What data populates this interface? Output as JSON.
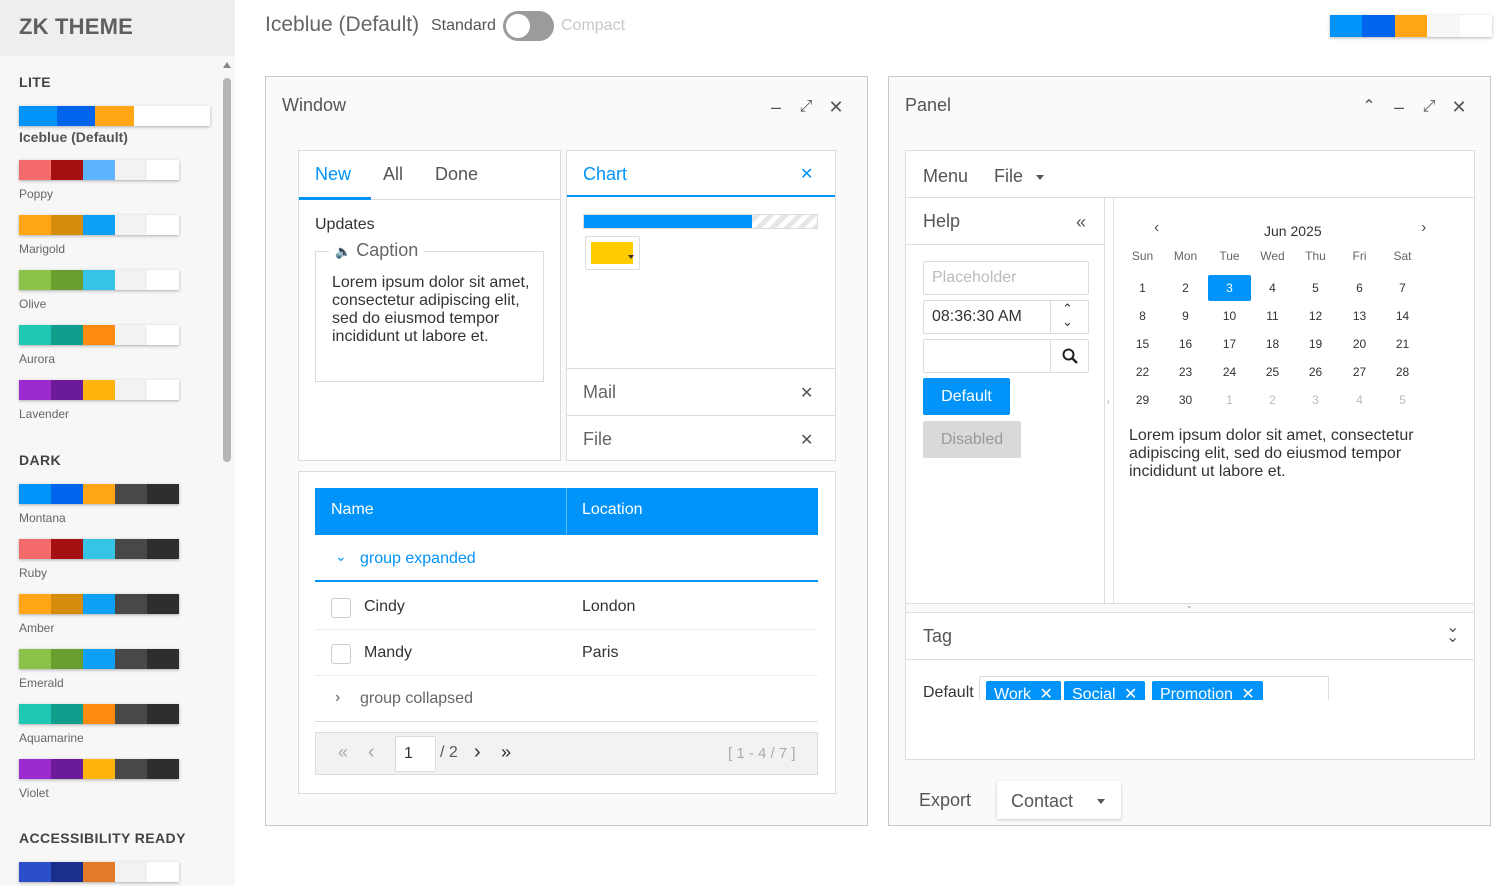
{
  "sidebar": {
    "brand": "ZK THEME",
    "sections": {
      "lite": "LITE",
      "dark": "DARK",
      "accessibility": "ACCESSIBILITY READY"
    },
    "lite_themes": [
      {
        "name": "Iceblue (Default)",
        "colors": [
          "#0093f9",
          "#0064ed",
          "#ffa516",
          "#ffffff",
          "#ffffff"
        ]
      },
      {
        "name": "Poppy",
        "colors": [
          "#f56a6a",
          "#a50f11",
          "#5cb4ff",
          "#f2f2f2",
          "#ffffff"
        ]
      },
      {
        "name": "Marigold",
        "colors": [
          "#ffa516",
          "#d48c0a",
          "#0ea0f5",
          "#f2f2f2",
          "#ffffff"
        ]
      },
      {
        "name": "Olive",
        "colors": [
          "#8bc34a",
          "#6a9f2f",
          "#36c4e6",
          "#f2f2f2",
          "#ffffff"
        ]
      },
      {
        "name": "Aurora",
        "colors": [
          "#1ec8b4",
          "#129e8c",
          "#ff8a10",
          "#f2f2f2",
          "#ffffff"
        ]
      },
      {
        "name": "Lavender",
        "colors": [
          "#9b2bcf",
          "#6b1a99",
          "#ffb50e",
          "#f2f2f2",
          "#ffffff"
        ]
      }
    ],
    "dark_themes": [
      {
        "name": "Montana",
        "colors": [
          "#0093f9",
          "#0064ed",
          "#ffa516",
          "#484848",
          "#2e2e2e"
        ]
      },
      {
        "name": "Ruby",
        "colors": [
          "#f56a6a",
          "#a50f11",
          "#36c4e6",
          "#484848",
          "#2e2e2e"
        ]
      },
      {
        "name": "Amber",
        "colors": [
          "#ffa516",
          "#d48c0a",
          "#0ea0f5",
          "#484848",
          "#2e2e2e"
        ]
      },
      {
        "name": "Emerald",
        "colors": [
          "#8bc34a",
          "#6a9f2f",
          "#0ea0f5",
          "#484848",
          "#2e2e2e"
        ]
      },
      {
        "name": "Aquamarine",
        "colors": [
          "#1ec8b4",
          "#129e8c",
          "#ff8a10",
          "#484848",
          "#2e2e2e"
        ]
      },
      {
        "name": "Violet",
        "colors": [
          "#9b2bcf",
          "#6b1a99",
          "#ffb50e",
          "#484848",
          "#2e2e2e"
        ]
      }
    ],
    "accessibility_themes": [
      {
        "name": "",
        "colors": [
          "#2b4fc9",
          "#1a2f8c",
          "#e27a28",
          "#f2f2f2",
          "#ffffff"
        ]
      }
    ]
  },
  "topbar": {
    "current_theme": "Iceblue (Default)",
    "standard_label": "Standard",
    "compact_label": "Compact",
    "swatch_colors": [
      "#0093f9",
      "#0064ed",
      "#ffa516",
      "#f7f7f7",
      "#ffffff"
    ]
  },
  "window": {
    "title": "Window",
    "tabs": [
      "New",
      "All",
      "Done"
    ],
    "updates_label": "Updates",
    "caption_label": "Caption",
    "lorem": "Lorem ipsum dolor sit amet, consectetur adipiscing elit, sed do eiusmod tempor incididunt ut labore et.",
    "accordion": {
      "chart_label": "Chart",
      "mail_label": "Mail",
      "file_label": "File",
      "progress": 0.72,
      "color_value": "#ffcc00"
    },
    "grid": {
      "columns": [
        "Name",
        "Location"
      ],
      "group_expanded": "group expanded",
      "rows": [
        {
          "name": "Cindy",
          "location": "London"
        },
        {
          "name": "Mandy",
          "location": "Paris"
        }
      ],
      "group_collapsed": "group collapsed",
      "paging": {
        "page": "1",
        "total": "/ 2",
        "info": "[ 1 - 4 / 7 ]"
      }
    }
  },
  "panel": {
    "title": "Panel",
    "menu": {
      "menu_label": "Menu",
      "file_label": "File"
    },
    "help_label": "Help",
    "placeholder": "Placeholder",
    "time_value": "08:36:30 AM",
    "default_button": "Default",
    "disabled_button": "Disabled",
    "calendar": {
      "month": "Jun 2025",
      "dow": [
        "Sun",
        "Mon",
        "Tue",
        "Wed",
        "Thu",
        "Fri",
        "Sat"
      ],
      "weeks": [
        [
          "1",
          "2",
          "3",
          "4",
          "5",
          "6",
          "7"
        ],
        [
          "8",
          "9",
          "10",
          "11",
          "12",
          "13",
          "14"
        ],
        [
          "15",
          "16",
          "17",
          "18",
          "19",
          "20",
          "21"
        ],
        [
          "22",
          "23",
          "24",
          "25",
          "26",
          "27",
          "28"
        ],
        [
          "29",
          "30",
          "1",
          "2",
          "3",
          "4",
          "5"
        ]
      ],
      "selected": "3"
    },
    "lorem": "Lorem ipsum dolor sit amet, consectetur adipiscing elit, sed do eiusmod tempor incididunt ut labore et.",
    "tag": {
      "title": "Tag",
      "label": "Default",
      "chips": [
        "Work",
        "Social",
        "Promotion"
      ]
    },
    "footer": {
      "export_label": "Export",
      "contact_label": "Contact"
    }
  }
}
